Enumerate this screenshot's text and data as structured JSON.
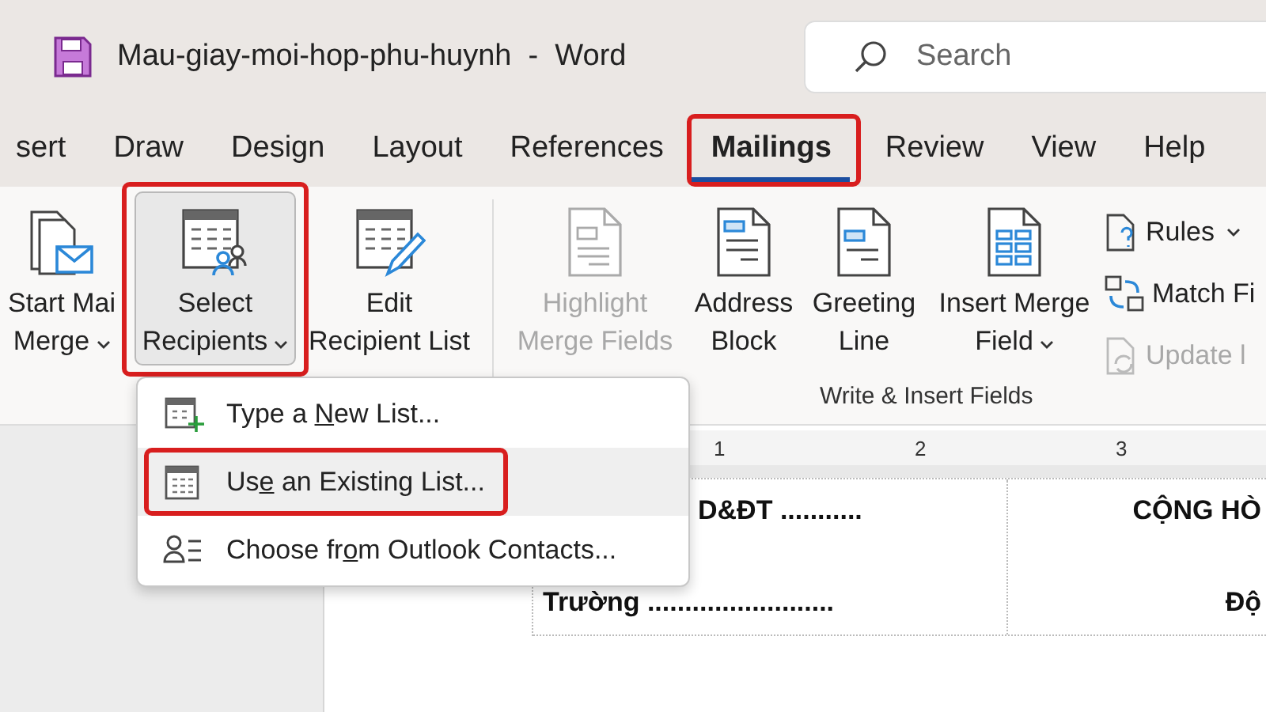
{
  "window": {
    "title": "Mau-giay-moi-hop-phu-huynh  -  Word"
  },
  "search": {
    "placeholder": "Search"
  },
  "tabs": [
    {
      "label": "sert",
      "selected": false,
      "highlighted": false
    },
    {
      "label": "Draw",
      "selected": false,
      "highlighted": false
    },
    {
      "label": "Design",
      "selected": false,
      "highlighted": false
    },
    {
      "label": "Layout",
      "selected": false,
      "highlighted": false
    },
    {
      "label": "References",
      "selected": false,
      "highlighted": false
    },
    {
      "label": "Mailings",
      "selected": true,
      "highlighted": true
    },
    {
      "label": "Review",
      "selected": false,
      "highlighted": false
    },
    {
      "label": "View",
      "selected": false,
      "highlighted": false
    },
    {
      "label": "Help",
      "selected": false,
      "highlighted": false
    }
  ],
  "ribbon": {
    "buttons": [
      {
        "lines": [
          "Start Mai",
          "Merge"
        ],
        "dropdown": true,
        "pressed": false,
        "disabled": false,
        "highlighted": false
      },
      {
        "lines": [
          "Select",
          "Recipients"
        ],
        "dropdown": true,
        "pressed": true,
        "disabled": false,
        "highlighted": true
      },
      {
        "lines": [
          "Edit",
          "Recipient List"
        ],
        "dropdown": false,
        "pressed": false,
        "disabled": false,
        "highlighted": false
      },
      {
        "lines": [
          "Highlight",
          "Merge Fields"
        ],
        "dropdown": false,
        "pressed": false,
        "disabled": true,
        "highlighted": false
      },
      {
        "lines": [
          "Address",
          "Block"
        ],
        "dropdown": false,
        "pressed": false,
        "disabled": false,
        "highlighted": false
      },
      {
        "lines": [
          "Greeting",
          "Line"
        ],
        "dropdown": false,
        "pressed": false,
        "disabled": false,
        "highlighted": false
      },
      {
        "lines": [
          "Insert Merge",
          "Field"
        ],
        "dropdown": true,
        "pressed": false,
        "disabled": false,
        "highlighted": false
      }
    ],
    "small_buttons": [
      {
        "label": "Rules",
        "dropdown": true,
        "disabled": false
      },
      {
        "label": "Match Fi",
        "disabled": false
      },
      {
        "label": "Update l",
        "disabled": true
      }
    ],
    "group_label": "Write & Insert Fields"
  },
  "menu": {
    "items": [
      {
        "before": "Type a ",
        "key": "N",
        "after": "ew List...",
        "selected": false,
        "highlighted": false
      },
      {
        "before": "Us",
        "key": "e",
        "after": " an Existing List...",
        "selected": true,
        "highlighted": true
      },
      {
        "before": "Choose fr",
        "key": "o",
        "after": "m Outlook Contacts...",
        "selected": false,
        "highlighted": false
      }
    ]
  },
  "ruler": {
    "marks": [
      "1",
      "2",
      "3"
    ]
  },
  "document": {
    "rows": [
      [
        "D&ĐT ...........",
        "CỘNG HÒ"
      ],
      [
        "Trường .........................",
        "Độ"
      ]
    ]
  }
}
